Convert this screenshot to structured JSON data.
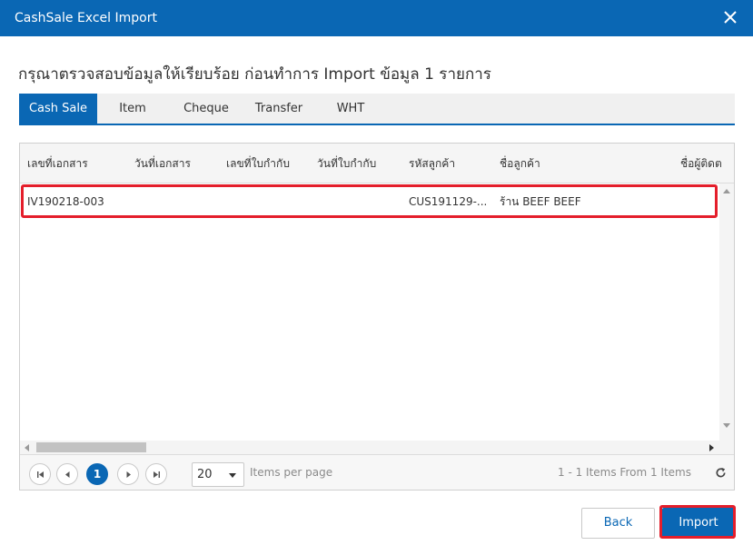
{
  "dialog": {
    "title": "CashSale Excel Import",
    "heading": "กรุณาตรวจสอบข้อมูลให้เรียบร้อย ก่อนทำการ Import ข้อมูล 1 รายการ",
    "accent_color": "#0a67b4",
    "highlight_color": "#e41e2b"
  },
  "tabs": [
    {
      "label": "Cash Sale",
      "active": true
    },
    {
      "label": "Item",
      "active": false
    },
    {
      "label": "Cheque",
      "active": false
    },
    {
      "label": "Transfer",
      "active": false
    },
    {
      "label": "WHT",
      "active": false
    }
  ],
  "grid": {
    "columns": [
      "เลขที่เอกสาร",
      "วันที่เอกสาร",
      "เลขที่ใบกำกับ",
      "วันที่ใบกำกับ",
      "รหัสลูกค้า",
      "ชื่อลูกค้า",
      "ชื่อผู้ติดต"
    ],
    "rows": [
      [
        "IV190218-003",
        "",
        "",
        "",
        "CUS191129-...",
        "ร้าน BEEF BEEF",
        ""
      ]
    ]
  },
  "pager": {
    "current_page": "1",
    "page_size": "20",
    "items_per_page_label": "Items per page",
    "info": "1 - 1 Items From 1 Items"
  },
  "buttons": {
    "back": "Back",
    "import": "Import"
  },
  "icons": [
    "close-icon",
    "first-page-icon",
    "prev-page-icon",
    "next-page-icon",
    "last-page-icon",
    "refresh-icon",
    "chevron-down-icon"
  ]
}
